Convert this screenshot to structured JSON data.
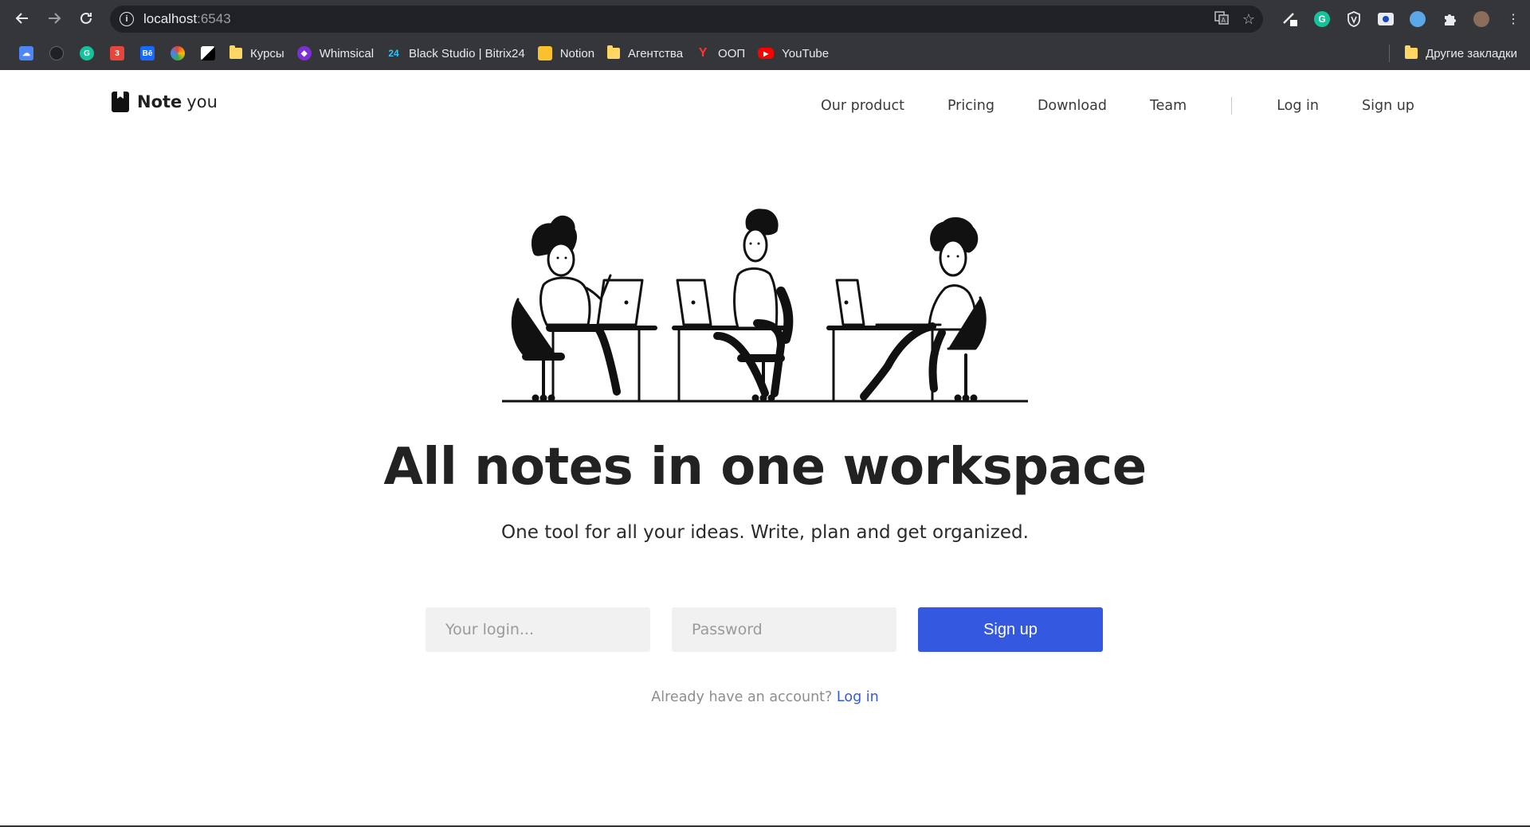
{
  "browser": {
    "url_host": "localhost",
    "url_port": ":6543",
    "bookmarks": [
      {
        "label": "",
        "icon": "cloud-icon",
        "color": "#4f86f7"
      },
      {
        "label": "",
        "icon": "github-icon",
        "color": "#202124"
      },
      {
        "label": "",
        "icon": "grammarly-icon",
        "color": "#15c39a"
      },
      {
        "label": "",
        "icon": "calendar-icon",
        "color": "#e8453c"
      },
      {
        "label": "",
        "icon": "behance-icon",
        "color": "#1769ff"
      },
      {
        "label": "",
        "icon": "wheel-icon",
        "color": "#34a853"
      },
      {
        "label": "",
        "icon": "contrast-icon",
        "color": "#ffffff"
      },
      {
        "label": "Курсы",
        "icon": "folder-icon"
      },
      {
        "label": "Whimsical",
        "icon": "whimsical-icon",
        "color": "#7b2fd6"
      },
      {
        "label": "Black Studio | Bitrix24",
        "icon": "bitrix-icon",
        "color": "#2fc6f6"
      },
      {
        "label": "Notion",
        "icon": "notion-icon",
        "color": "#fbc02d"
      },
      {
        "label": "Агентства",
        "icon": "folder-icon"
      },
      {
        "label": "ООП",
        "icon": "yandex-icon",
        "color": "#ff3333"
      },
      {
        "label": "YouTube",
        "icon": "youtube-icon",
        "color": "#ff0000"
      }
    ],
    "other_bookmarks": "Другие закладки"
  },
  "brand": {
    "name": "Note",
    "suffix": "you"
  },
  "nav": {
    "product": "Our product",
    "pricing": "Pricing",
    "download": "Download",
    "team": "Team",
    "login": "Log in",
    "signup": "Sign up"
  },
  "hero": {
    "headline": "All notes in one workspace",
    "subline": "One tool for all your ideas. Write, plan and get organized."
  },
  "form": {
    "login_placeholder": "Your login...",
    "password_placeholder": "Password",
    "submit_label": "Sign up"
  },
  "footer_prompt": {
    "text": "Already have an account?",
    "link": "Log in"
  },
  "colors": {
    "accent": "#3558e0",
    "chrome_bg": "#35363a"
  }
}
